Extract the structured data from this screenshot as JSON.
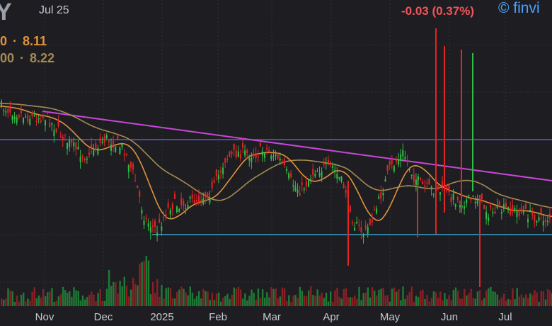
{
  "header": {
    "ticker": "Y",
    "date": "Jul 25",
    "change": "-0.03 (0.37%)",
    "brand": "© finvi"
  },
  "moving_averages": [
    {
      "period": "0",
      "value": "8.11",
      "color": "#e0923c"
    },
    {
      "period": "00",
      "value": "8.22",
      "color": "#a48a52"
    }
  ],
  "chart_data": {
    "type": "candlestick",
    "x_tick_labels": [
      "Nov",
      "Dec",
      "2025",
      "Feb",
      "Mar",
      "Apr",
      "May",
      "Jun",
      "Jul"
    ],
    "grid": true,
    "colors": {
      "up": "#2fbf46",
      "down": "#e52424",
      "ma_fast": "#e0923c",
      "ma_slow": "#a48a52",
      "trendline": "#c847d8",
      "support": "#3aa0c8",
      "resistance": "#5a5ad8"
    },
    "notes": "Daily candles with volume bars; falling trendline; horizontal support and resistance lines"
  }
}
